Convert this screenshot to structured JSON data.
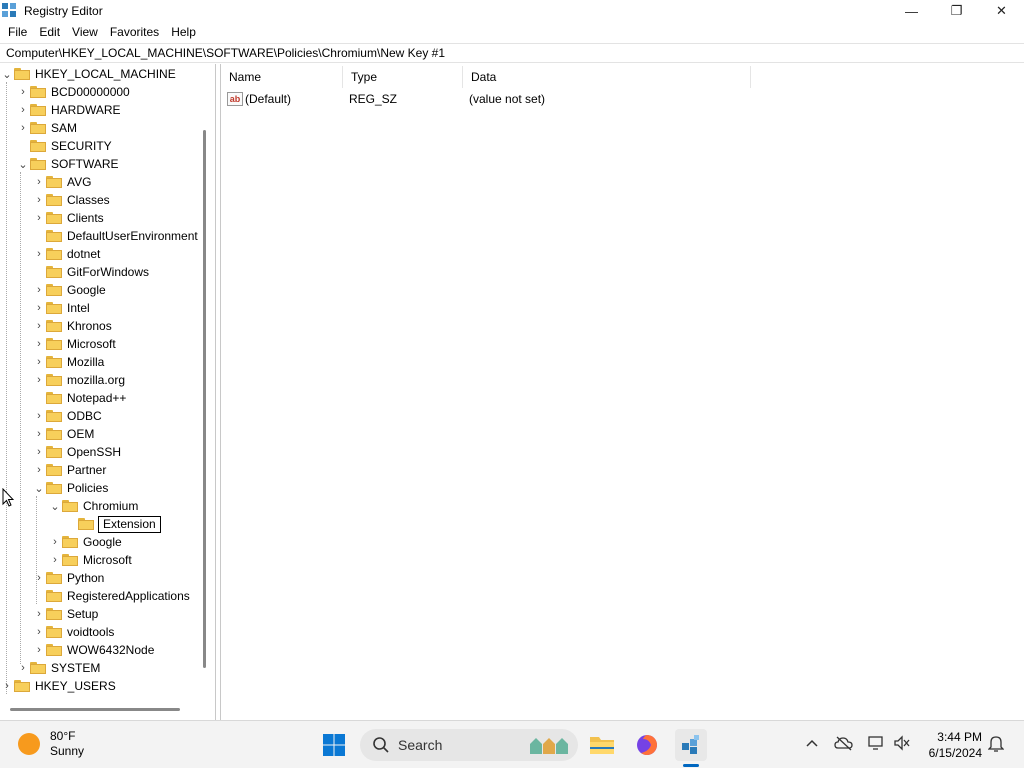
{
  "window": {
    "title": "Registry Editor",
    "minimize": "—",
    "maximize": "❐",
    "close": "✕"
  },
  "menu": [
    "File",
    "Edit",
    "View",
    "Favorites",
    "Help"
  ],
  "address": "Computer\\HKEY_LOCAL_MACHINE\\SOFTWARE\\Policies\\Chromium\\New Key #1",
  "tree": [
    {
      "label": "HKEY_LOCAL_MACHINE",
      "expander": "⌄"
    },
    {
      "label": "BCD00000000",
      "expander": "›"
    },
    {
      "label": "HARDWARE",
      "expander": "›"
    },
    {
      "label": "SAM",
      "expander": "›"
    },
    {
      "label": "SECURITY",
      "expander": ""
    },
    {
      "label": "SOFTWARE",
      "expander": "⌄"
    },
    {
      "label": "AVG",
      "expander": "›"
    },
    {
      "label": "Classes",
      "expander": "›"
    },
    {
      "label": "Clients",
      "expander": "›"
    },
    {
      "label": "DefaultUserEnvironment",
      "expander": ""
    },
    {
      "label": "dotnet",
      "expander": "›"
    },
    {
      "label": "GitForWindows",
      "expander": ""
    },
    {
      "label": "Google",
      "expander": "›"
    },
    {
      "label": "Intel",
      "expander": "›"
    },
    {
      "label": "Khronos",
      "expander": "›"
    },
    {
      "label": "Microsoft",
      "expander": "›"
    },
    {
      "label": "Mozilla",
      "expander": "›"
    },
    {
      "label": "mozilla.org",
      "expander": "›"
    },
    {
      "label": "Notepad++",
      "expander": ""
    },
    {
      "label": "ODBC",
      "expander": "›"
    },
    {
      "label": "OEM",
      "expander": "›"
    },
    {
      "label": "OpenSSH",
      "expander": "›"
    },
    {
      "label": "Partner",
      "expander": "›"
    },
    {
      "label": "Policies",
      "expander": "⌄"
    },
    {
      "label": "Chromium",
      "expander": "⌄"
    },
    {
      "label": "Extension",
      "expander": ""
    },
    {
      "label": "Google",
      "expander": "›"
    },
    {
      "label": "Microsoft",
      "expander": "›"
    },
    {
      "label": "Python",
      "expander": "›"
    },
    {
      "label": "RegisteredApplications",
      "expander": ""
    },
    {
      "label": "Setup",
      "expander": "›"
    },
    {
      "label": "voidtools",
      "expander": "›"
    },
    {
      "label": "WOW6432Node",
      "expander": "›"
    },
    {
      "label": "SYSTEM",
      "expander": "›"
    },
    {
      "label": "HKEY_USERS",
      "expander": "›"
    }
  ],
  "list": {
    "columns": [
      "Name",
      "Type",
      "Data"
    ],
    "rows": [
      {
        "name": "(Default)",
        "type": "REG_SZ",
        "data": "(value not set)"
      }
    ]
  },
  "taskbar": {
    "weather_temp": "80°F",
    "weather_desc": "Sunny",
    "search_placeholder": "Search",
    "time": "3:44 PM",
    "date": "6/15/2024"
  },
  "colors": {
    "folder": "#f7cf5b",
    "accent": "#0067c0",
    "taskbar_bg": "#f3f3f3"
  }
}
